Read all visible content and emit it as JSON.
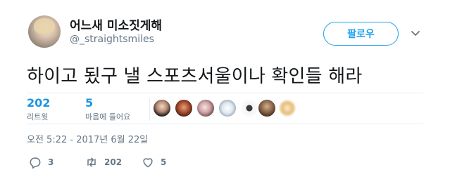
{
  "header": {
    "display_name": "어느새 미소짓게해",
    "handle": "@_straightsmiles",
    "follow_label": "팔로우"
  },
  "tweet": {
    "text": "하이고 됬구 낼 스포츠서울이나 확인들 해라",
    "timestamp": "오전 5:22 - 2017년 6월 22일"
  },
  "stats": {
    "retweets": {
      "count": "202",
      "label": "리트윗"
    },
    "likes": {
      "count": "5",
      "label": "마음에 들어요"
    }
  },
  "likers": [
    "avatar-1",
    "avatar-2",
    "avatar-3",
    "avatar-4",
    "avatar-5",
    "avatar-6",
    "avatar-7"
  ],
  "actions": {
    "reply_count": "3",
    "retweet_count": "202",
    "like_count": "5"
  },
  "icons": {
    "reply": "reply-icon",
    "retweet": "retweet-icon",
    "like": "heart-icon",
    "caret": "chevron-down-icon"
  },
  "colors": {
    "accent": "#1da1f2",
    "muted": "#657786",
    "divider": "#e6ecf0"
  }
}
